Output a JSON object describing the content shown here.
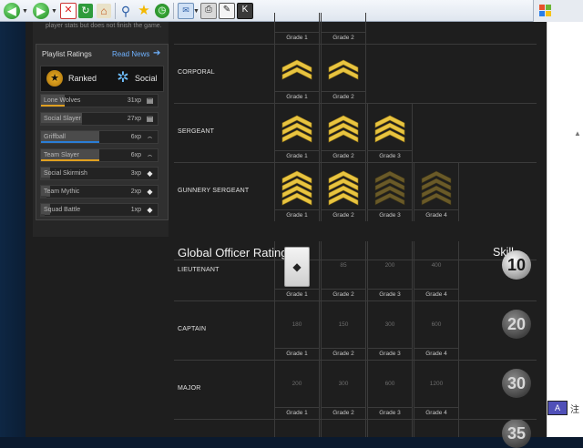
{
  "toolbar": {
    "icons": [
      "back-icon",
      "forward-icon",
      "stop-icon",
      "refresh-icon",
      "home-icon",
      "search-icon",
      "favorites-icon",
      "history-icon",
      "mail-icon",
      "print-icon",
      "edit-icon"
    ]
  },
  "sidebar": {
    "top_text": "player stats but does not finish the game.",
    "title": "Playlist Ratings",
    "read_news": "Read News",
    "tabs": [
      {
        "label": "Ranked",
        "icon": "star-icon"
      },
      {
        "label": "Social",
        "icon": "social-icon"
      }
    ],
    "playlists": [
      {
        "name": "Lone Wolves",
        "xp": "31xp",
        "icon": "document-icon",
        "fill": 0.2,
        "bar_color": "#e0a020"
      },
      {
        "name": "Social Slayer",
        "xp": "27xp",
        "icon": "document-icon",
        "fill": 0.35,
        "bar_color": "#3a3a3a"
      },
      {
        "name": "Griffball",
        "xp": "6xp",
        "icon": "cap-icon",
        "fill": 0.5,
        "bar_color": "#2a7dd6"
      },
      {
        "name": "Team Slayer",
        "xp": "6xp",
        "icon": "cap-icon",
        "fill": 0.5,
        "bar_color": "#e0a020"
      },
      {
        "name": "Social Skirmish",
        "xp": "3xp",
        "icon": "diamond-icon",
        "fill": 0.08,
        "bar_color": "#3a3a3a"
      },
      {
        "name": "Team Mythic",
        "xp": "2xp",
        "icon": "diamond-icon",
        "fill": 0.05,
        "bar_color": "#3a3a3a"
      },
      {
        "name": "Squad Battle",
        "xp": "1xp",
        "icon": "diamond-icon",
        "fill": 0.03,
        "bar_color": "#3a3a3a"
      }
    ]
  },
  "main": {
    "top_grades": [
      "Grade 1",
      "Grade 2"
    ],
    "enlisted": [
      {
        "rank": "CORPORAL",
        "grades": [
          "Grade 1",
          "Grade 2"
        ],
        "style": "gold"
      },
      {
        "rank": "SERGEANT",
        "grades": [
          "Grade 1",
          "Grade 2",
          "Grade 3"
        ],
        "style": "gold"
      },
      {
        "rank": "GUNNERY SERGEANT",
        "grades": [
          "Grade 1",
          "Grade 2",
          "Grade 3",
          "Grade 4"
        ],
        "style": "gold-dim"
      }
    ],
    "officer_title": "Global Officer Ratings",
    "skill_title": "Skill",
    "officers": [
      {
        "rank": "LIEUTENANT",
        "grades": [
          "Grade 1",
          "Grade 2",
          "Grade 3",
          "Grade 4"
        ],
        "values": [
          "",
          "85",
          "200",
          "400"
        ],
        "skill": "10"
      },
      {
        "rank": "CAPTAIN",
        "grades": [
          "Grade 1",
          "Grade 2",
          "Grade 3",
          "Grade 4"
        ],
        "values": [
          "180",
          "150",
          "300",
          "600"
        ],
        "skill": "20"
      },
      {
        "rank": "MAJOR",
        "grades": [
          "Grade 1",
          "Grade 2",
          "Grade 3",
          "Grade 4"
        ],
        "values": [
          "200",
          "300",
          "600",
          "1200"
        ],
        "skill": "30"
      }
    ],
    "next_skill": "35"
  },
  "status": {
    "ime_icon": "ime-icon",
    "ime_text": "注"
  }
}
